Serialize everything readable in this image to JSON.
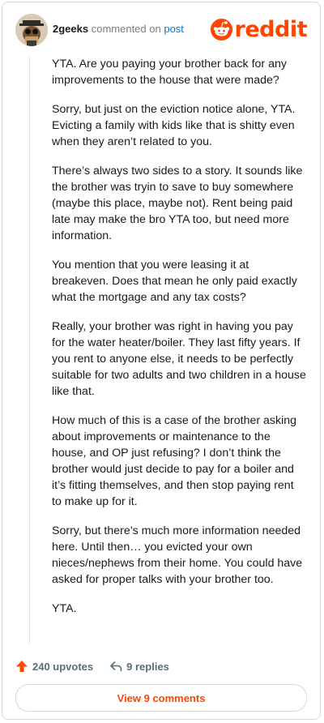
{
  "header": {
    "username": "2geeks",
    "action_text": "commented on",
    "post_link": "post",
    "logo_text": "reddit"
  },
  "comment": {
    "paragraphs": [
      "YTA. Are you paying your brother back for any improvements to the house that were made?",
      "Sorry, but just on the eviction notice alone, YTA. Evicting a family with kids like that is shitty even when they aren’t related to you.",
      "There’s always two sides to a story. It sounds like the brother was tryin to save to buy somewhere (maybe this place, maybe not). Rent being paid late may make the bro YTA too, but need more information.",
      "You mention that you were leasing it at breakeven. Does that mean he only paid exactly what the mortgage and any tax costs?",
      "Really, your brother was right in having you pay for the water heater/boiler. They last fifty years. If you rent to anyone else, it needs to be perfectly suitable for two adults and two children in a house like that.",
      "How much of this is a case of the brother asking about improvements or maintenance to the house, and OP just refusing? I don’t think the brother would just decide to pay for a boiler and it’s fitting themselves, and then stop paying rent to make up for it.",
      "Sorry, but there’s much more information needed here. Until then… you evicted your own nieces/nephews from their home. You could have asked for proper talks with your brother too.",
      "YTA."
    ]
  },
  "actions": {
    "upvotes": "240 upvotes",
    "replies": "9 replies",
    "view_comments": "View 9 comments"
  },
  "colors": {
    "brand": "#ff4500",
    "link": "#0079d3",
    "muted": "#576f76"
  }
}
